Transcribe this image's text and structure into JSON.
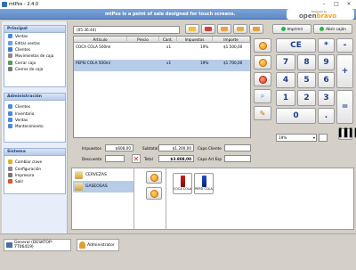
{
  "window": {
    "title": "mtPos - 2.4.0"
  },
  "topbar": {
    "message": "mtPos is a point of sale designed for touch screens.",
    "logo_small": "Powered by",
    "logo_a": "open",
    "logo_b": "bravo"
  },
  "sidebar": {
    "principal": {
      "title": "Principal",
      "items": [
        "Ventas",
        "Editar ventas",
        "Clientes",
        "Movimientos de caja",
        "Cerrar caja",
        "Cierres de caja"
      ]
    },
    "administracion": {
      "title": "Administración",
      "items": [
        "Clientes",
        "Inventario",
        "Ventas",
        "Mantenimiento"
      ]
    },
    "sistema": {
      "title": "Sistema",
      "items": [
        "Cambiar clave",
        "Configuración",
        "Impresora",
        "Salir"
      ]
    }
  },
  "toolbar": {
    "ticket_id": "(05:36:44)",
    "print_label": "Imprimir",
    "drawer_label": "Abrir cajón"
  },
  "ticket": {
    "columns": [
      "Artículo",
      "Precio",
      "Cant.",
      "Impuestos",
      "Importe"
    ],
    "rows": [
      {
        "item": "COCA COLA 500ml",
        "price": "",
        "qty": "x1",
        "tax": "19%",
        "amount": "$1.500,00"
      },
      {
        "item": "PEPSI COLA 500ml",
        "price": "",
        "qty": "x1",
        "tax": "19%",
        "amount": "$1.700,00"
      }
    ]
  },
  "totals": {
    "impuestos_label": "Impuestos",
    "impuestos_value": "$608,00",
    "subtotal_label": "Subtotal",
    "subtotal_value": "$1.200,00",
    "descuento_label": "Descuento",
    "descuento_value": "",
    "total_label": "Total",
    "total_value": "$3.808,00",
    "cliente_label": "Cliente",
    "art_esp_label": "Art Esp"
  },
  "keypad": {
    "keys": [
      "CE",
      "*",
      "-",
      "7",
      "8",
      "9",
      "+",
      "4",
      "5",
      "6",
      "1",
      "2",
      "3",
      "=",
      "0",
      "."
    ],
    "tax_select": "19%"
  },
  "categories": [
    "CERVEZAS",
    "GASEOSAS"
  ],
  "products": [
    "COCA COLA 500ml",
    "PEPSI COLA 500ml"
  ],
  "statusbar": {
    "host": "General (DESKTOP-7T06419)",
    "user": "Administrator"
  }
}
